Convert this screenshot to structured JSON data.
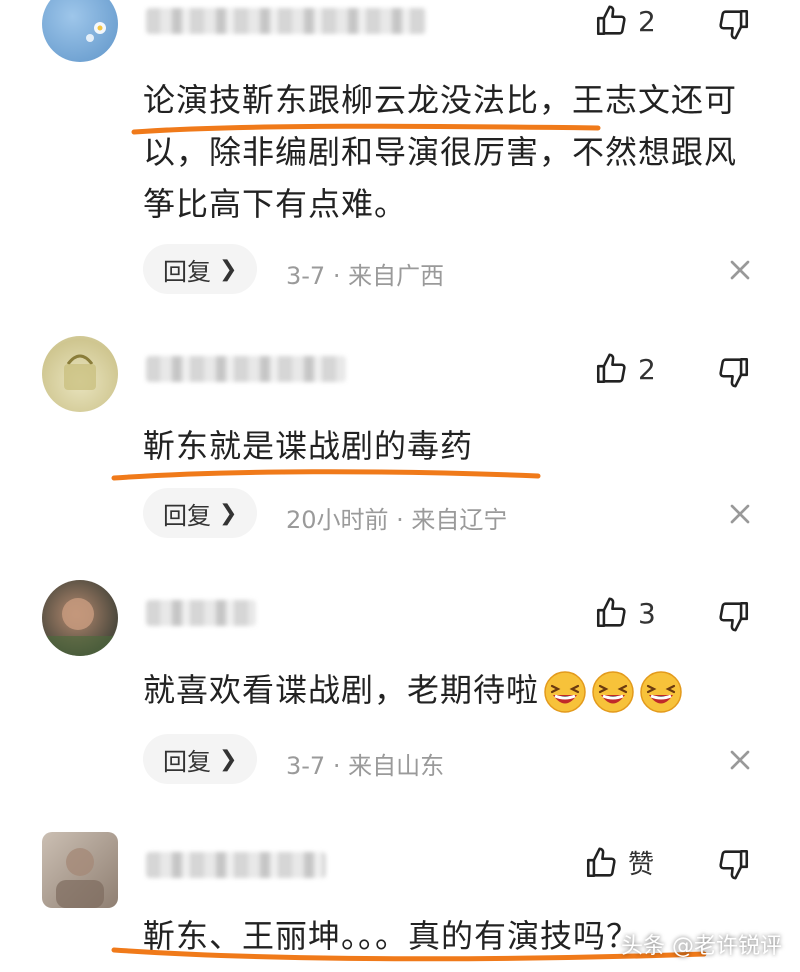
{
  "comments": [
    {
      "likes": "2",
      "text": "论演技靳东跟柳云龙没法比，王志文还可以，除非编剧和导演很厉害，不然想跟风筝比高下有点难。",
      "reply_label": "回复",
      "meta": "3-7 · 来自广西"
    },
    {
      "likes": "2",
      "text": "靳东就是谍战剧的毒药",
      "reply_label": "回复",
      "meta": "20小时前 · 来自辽宁"
    },
    {
      "likes": "3",
      "text": "就喜欢看谍战剧，老期待啦",
      "reply_label": "回复",
      "meta": "3-7 · 来自山东"
    },
    {
      "likes": "赞",
      "text": "靳东、王丽坤。。。真的有演技吗？"
    }
  ],
  "watermark": "头条 @老许锐评",
  "colors": {
    "underline": "#f07a1a",
    "text": "#222222",
    "meta": "#9a9a9a"
  },
  "icons": [
    "thumbs-up-icon",
    "thumbs-down-icon",
    "close-icon",
    "chevron-right-icon",
    "laughing-emoji-icon"
  ]
}
